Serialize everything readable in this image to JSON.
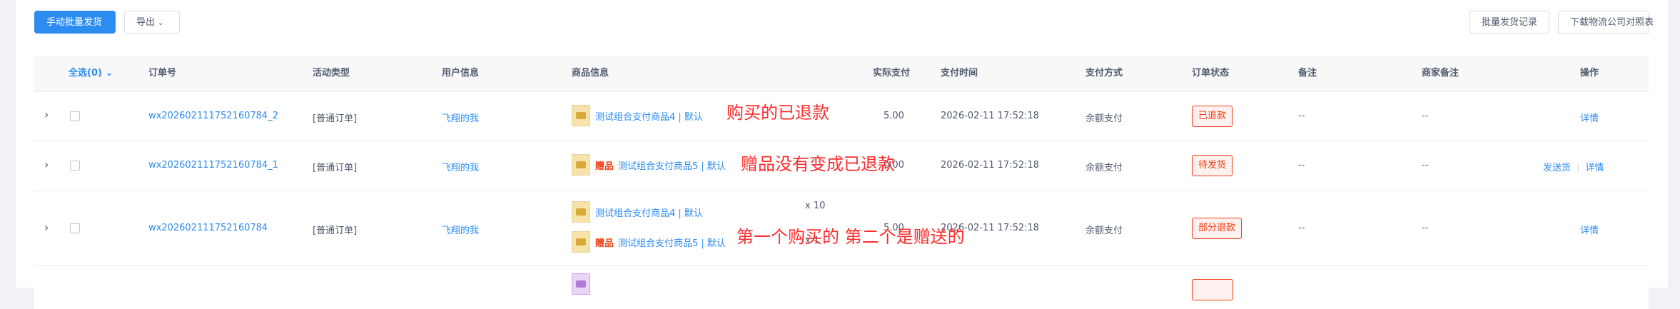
{
  "toolbar": {
    "manual_batch_ship": "手动批量发货",
    "export": "导出",
    "batch_ship_records": "批量发货记录",
    "download_logistics_map": "下载物流公司对照表"
  },
  "table": {
    "headers": {
      "select_all": "全选(0)",
      "order_no": "订单号",
      "activity_type": "活动类型",
      "user_info": "用户信息",
      "product_info": "商品信息",
      "actual_paid": "实际支付",
      "pay_time": "支付时间",
      "pay_method": "支付方式",
      "order_status": "订单状态",
      "remark": "备注",
      "merchant_remark": "商家备注",
      "actions": "操作"
    },
    "rows": [
      {
        "order_no": "wx202602111752160784_2",
        "activity_type": "[普通订单]",
        "user": "飞翔的我",
        "product": "测试组合支付商品4 | 默认",
        "paid": "5.00",
        "pay_time": "2026-02-11 17:52:18",
        "pay_method": "余额支付",
        "status": "已退款",
        "remark": "--",
        "merchant_remark": "--",
        "detail": "详情"
      },
      {
        "order_no": "wx202602111752160784_1",
        "activity_type": "[普通订单]",
        "user": "飞翔的我",
        "gift": "赠品",
        "product": "测试组合支付商品5 | 默认",
        "paid": "0.00",
        "pay_time": "2026-02-11 17:52:18",
        "pay_method": "余额支付",
        "status": "待发货",
        "remark": "--",
        "merchant_remark": "--",
        "ship": "发送货",
        "detail": "详情"
      },
      {
        "order_no": "wx202602111752160784",
        "activity_type": "[普通订单]",
        "user": "飞翔的我",
        "product1": "测试组合支付商品4 | 默认",
        "qty1": "x 10",
        "gift": "赠品",
        "product2": "测试组合支付商品5 | 默认",
        "qty2": "x 1",
        "paid": "5.00",
        "pay_time": "2026-02-11 17:52:18",
        "pay_method": "余额支付",
        "status": "部分退款",
        "remark": "--",
        "merchant_remark": "--",
        "detail": "详情"
      }
    ]
  },
  "annotations": {
    "a1": "购买的已退款",
    "a2": "赠品没有变成已退款",
    "a3": "第一个购买的  第二个是赠送的"
  }
}
